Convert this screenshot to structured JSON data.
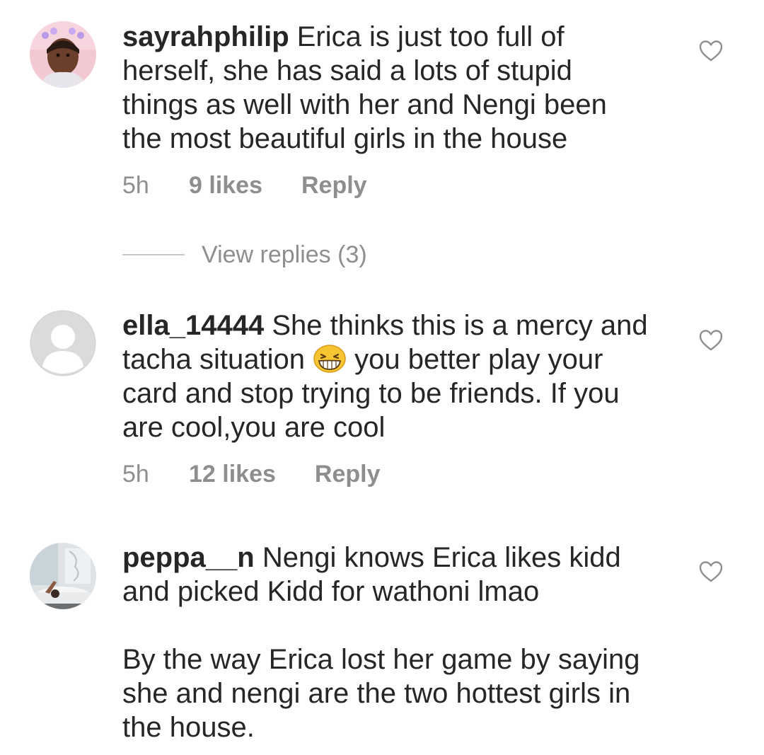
{
  "comments": [
    {
      "username": "sayrahphilip",
      "text_lines": [
        " Erica is just too full of",
        "herself, she has said a lots of stupid",
        "things as well with her and Nengi been",
        "the most beautiful girls in the house"
      ],
      "time": "5h",
      "likes": "9 likes",
      "reply_label": "Reply",
      "avatar_icon": "profile-photo-avatar",
      "like_icon": "heart-outline-icon"
    },
    {
      "username": "ella_14444",
      "text_line1": " She thinks this is a mercy and",
      "text_line2_before_emoji": "tacha situation ",
      "emoji": "grinning-squinting-face-emoji",
      "text_line2_after_emoji": " you better play your",
      "text_line3": "card and stop trying to be friends. If you",
      "text_line4": "are cool,you are cool",
      "time": "5h",
      "likes": "12 likes",
      "reply_label": "Reply",
      "avatar_icon": "default-user-avatar",
      "like_icon": "heart-outline-icon"
    },
    {
      "username": "peppa__n",
      "text_lines": [
        " Nengi knows Erica likes kidd",
        "and picked Kidd for wathoni lmao",
        "",
        "By the way Erica lost her game by saying",
        "she and nengi are the two hottest girls in",
        "the house."
      ],
      "avatar_icon": "bath-photo-avatar",
      "like_icon": "heart-outline-icon"
    }
  ],
  "view_replies": "View replies (3)",
  "colors": {
    "text": "#262626",
    "muted": "#8e8e8e",
    "divider": "#c7c7c7",
    "background": "#ffffff"
  }
}
